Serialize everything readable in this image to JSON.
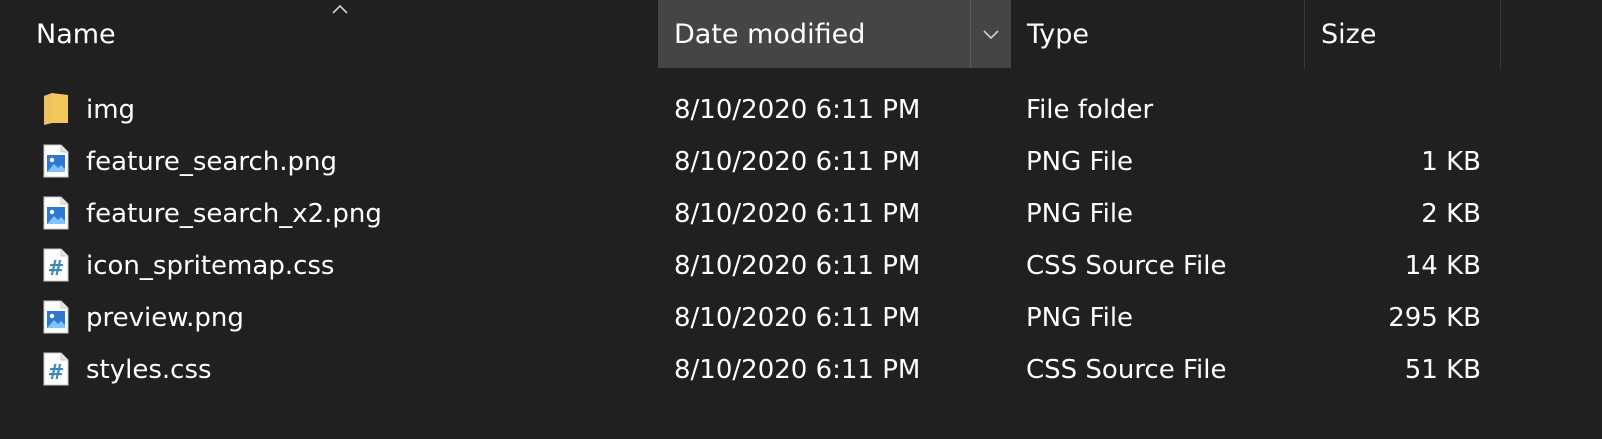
{
  "columns": {
    "name": "Name",
    "date_modified": "Date modified",
    "type": "Type",
    "size": "Size"
  },
  "sort": {
    "column": "name",
    "direction": "ascending"
  },
  "files": [
    {
      "name": "img",
      "date": "8/10/2020 6:11 PM",
      "type": "File folder",
      "size": "",
      "icon": "folder-icon"
    },
    {
      "name": "feature_search.png",
      "date": "8/10/2020 6:11 PM",
      "type": "PNG File",
      "size": "1 KB",
      "icon": "image-file-icon"
    },
    {
      "name": "feature_search_x2.png",
      "date": "8/10/2020 6:11 PM",
      "type": "PNG File",
      "size": "2 KB",
      "icon": "image-file-icon"
    },
    {
      "name": "icon_spritemap.css",
      "date": "8/10/2020 6:11 PM",
      "type": "CSS Source File",
      "size": "14 KB",
      "icon": "css-file-icon"
    },
    {
      "name": "preview.png",
      "date": "8/10/2020 6:11 PM",
      "type": "PNG File",
      "size": "295 KB",
      "icon": "image-file-icon"
    },
    {
      "name": "styles.css",
      "date": "8/10/2020 6:11 PM",
      "type": "CSS Source File",
      "size": "51 KB",
      "icon": "css-file-icon"
    }
  ],
  "colors": {
    "background": "#202020",
    "header_hover": "#454545",
    "text": "#ffffff",
    "folder": "#f3c75a",
    "image_icon": "#2f78d0",
    "css_icon": "#3b86b8"
  }
}
